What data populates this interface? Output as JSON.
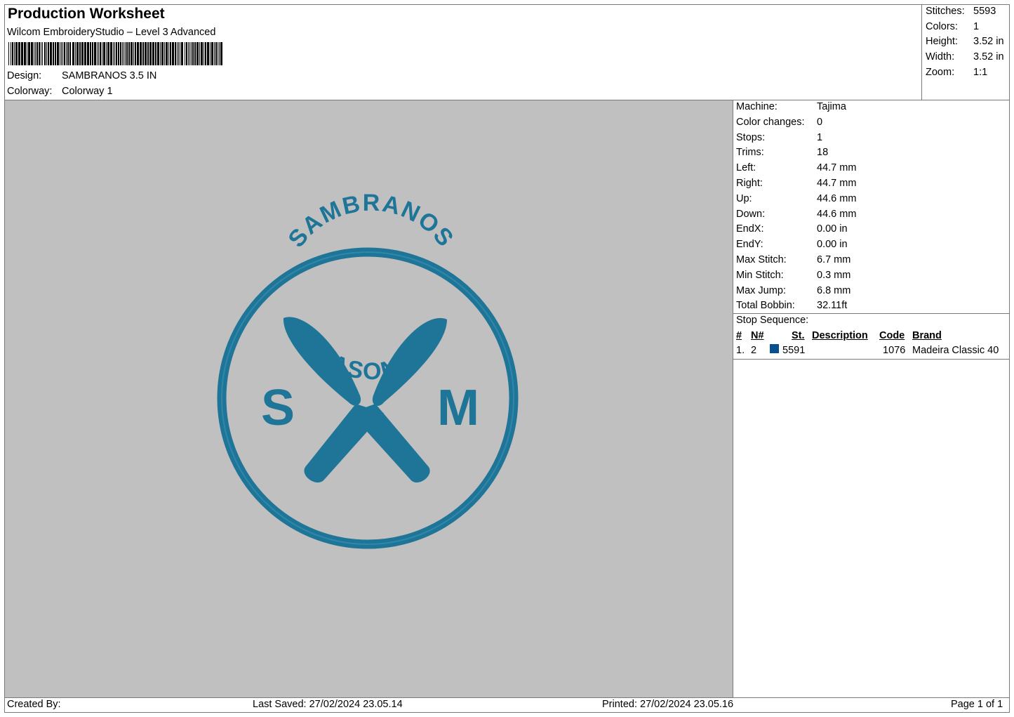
{
  "header": {
    "title": "Production Worksheet",
    "subtitle": "Wilcom EmbroideryStudio – Level 3 Advanced",
    "design_label": "Design:",
    "design_value": "SAMBRANOS 3.5 IN",
    "colorway_label": "Colorway:",
    "colorway_value": "Colorway 1"
  },
  "summary": [
    {
      "label": "Stitches:",
      "value": "5593"
    },
    {
      "label": "Colors:",
      "value": "1"
    },
    {
      "label": "Height:",
      "value": "3.52 in"
    },
    {
      "label": "Width:",
      "value": "3.52 in"
    },
    {
      "label": "Zoom:",
      "value": "1:1"
    }
  ],
  "machine_info": [
    {
      "label": "Machine:",
      "value": "Tajima"
    },
    {
      "label": "Color changes:",
      "value": "0"
    },
    {
      "label": "Stops:",
      "value": "1"
    },
    {
      "label": "Trims:",
      "value": "18"
    },
    {
      "label": "Left:",
      "value": "44.7 mm"
    },
    {
      "label": "Right:",
      "value": "44.7 mm"
    },
    {
      "label": "Up:",
      "value": "44.6 mm"
    },
    {
      "label": "Down:",
      "value": "44.6 mm"
    },
    {
      "label": "EndX:",
      "value": "0.00 in"
    },
    {
      "label": "EndY:",
      "value": "0.00 in"
    },
    {
      "label": "Max Stitch:",
      "value": "6.7 mm"
    },
    {
      "label": "Min Stitch:",
      "value": "0.3 mm"
    },
    {
      "label": "Max Jump:",
      "value": "6.8 mm"
    },
    {
      "label": "Total Bobbin:",
      "value": "32.11ft"
    }
  ],
  "stop_sequence": {
    "title": "Stop Sequence:",
    "columns": [
      "#",
      "N#",
      "St.",
      "Description",
      "Code",
      "Brand"
    ],
    "rows": [
      {
        "num": "1.",
        "n": "2",
        "swatch_color": "#0a4f8f",
        "stitches": "5591",
        "description": "",
        "code": "1076",
        "brand": "Madeira Classic 40"
      }
    ]
  },
  "design_artwork": {
    "top_text": "SAMBRANOS",
    "bottom_text": "MASONRY",
    "left_letter": "S",
    "right_letter": "M",
    "thread_color": "#1e7598",
    "background_color": "#c0c0c0"
  },
  "footer": {
    "created_by": "Created By:",
    "last_saved": "Last Saved: 27/02/2024 23.05.14",
    "printed": "Printed: 27/02/2024 23.05.16",
    "page": "Page 1 of 1"
  }
}
